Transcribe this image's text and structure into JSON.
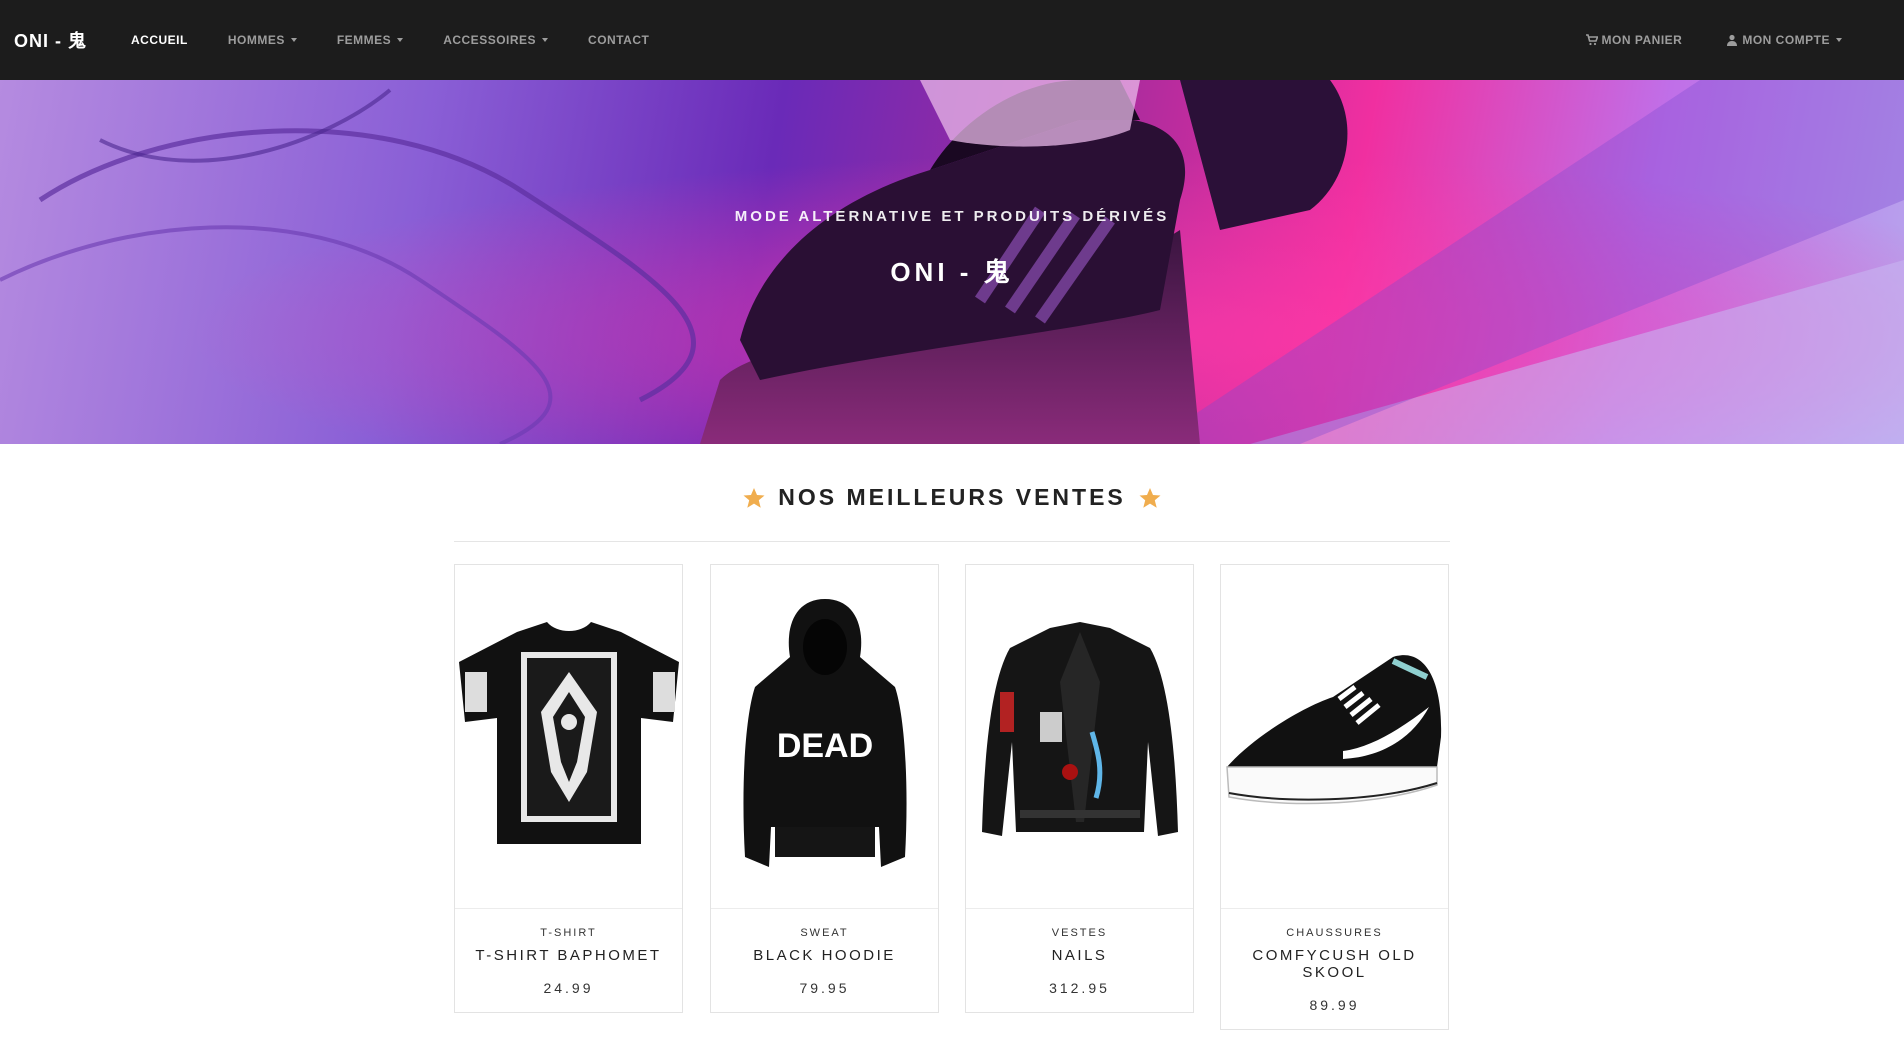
{
  "navbar": {
    "brand": "ONI - 鬼",
    "links": [
      {
        "label": "ACCUEIL",
        "active": true,
        "dropdown": false
      },
      {
        "label": "HOMMES",
        "active": false,
        "dropdown": true
      },
      {
        "label": "FEMMES",
        "active": false,
        "dropdown": true
      },
      {
        "label": "ACCESSOIRES",
        "active": false,
        "dropdown": true
      },
      {
        "label": "CONTACT",
        "active": false,
        "dropdown": false
      }
    ],
    "cart_label": "MON PANIER",
    "account_label": "MON COMPTE"
  },
  "hero": {
    "subtitle": "MODE ALTERNATIVE ET PRODUITS DÉRIVÉS",
    "title": "ONI - 鬼"
  },
  "bestsellers": {
    "title": "NOS MEILLEURS VENTES",
    "products": [
      {
        "category": "T-SHIRT",
        "name": "T-SHIRT BAPHOMET",
        "price": "24.99"
      },
      {
        "category": "SWEAT",
        "name": "BLACK HOODIE",
        "price": "79.95",
        "print_text": "DEAD"
      },
      {
        "category": "VESTES",
        "name": "NAILS",
        "price": "312.95"
      },
      {
        "category": "CHAUSSURES",
        "name": "COMFYCUSH OLD SKOOL",
        "price": "89.99"
      }
    ]
  },
  "colors": {
    "navbar_bg": "#1c1c1c",
    "accent_star": "#f0ad4e"
  }
}
